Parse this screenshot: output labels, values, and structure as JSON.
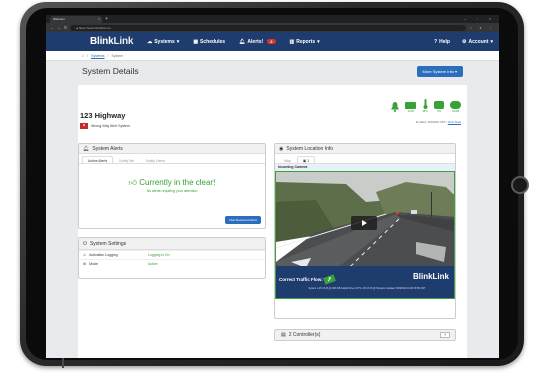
{
  "browser": {
    "tab_title": "Webcam",
    "new_tab": "+",
    "url": "https://www.blinklink.net"
  },
  "nav": {
    "logo_blink": "Blink",
    "logo_link": "Link",
    "systems": "Systems",
    "schedules": "Schedules",
    "alerts": "Alerts!",
    "alerts_count": "2",
    "reports": "Reports",
    "help": "Help",
    "account": "Account"
  },
  "breadcrumb": {
    "home": "⌂",
    "systems": "Systems",
    "sep": "/",
    "current": "System"
  },
  "page": {
    "title": "System Details",
    "more_info_button": "More System Info"
  },
  "system": {
    "name": "123 Highway",
    "type": "Wrong-Way Alert System",
    "status_labels": [
      "",
      "12.8V",
      "48°C",
      "ON",
      "34.6M"
    ],
    "last_updated": "11:20am, 8/3/2022 CDT •",
    "view_stats": "View Stats"
  },
  "alerts_panel": {
    "title": "System Alerts",
    "tabs": [
      "Active Alerts",
      "Notify Me",
      "Notify Users"
    ],
    "clear_message": "Currently in the clear!",
    "clear_sub": "No alerts requiring your attention",
    "resolved_button": "View Resolved Alerts"
  },
  "settings_panel": {
    "title": "System Settings",
    "rows": [
      {
        "label": "Activation Logging",
        "value": "Logging is On"
      },
      {
        "label": "Mode",
        "value": "Active"
      }
    ]
  },
  "location_panel": {
    "title": "System Location Info",
    "tabs": [
      "Map",
      "1"
    ],
    "incoming_label": "Incoming Camera",
    "traffic_flow": "Correct Traffic Flow:",
    "cam_logo": "BlinkLink",
    "cam_info": "System 1-45 US 45 @ 45th NB Capitol Drive CCTV I-45 US 45 @ Hampton  Updated: 8/03/2022 10:48:15 PM CDT"
  },
  "controllers": {
    "label": "2 Controller(s)",
    "toggle": "+"
  },
  "colors": {
    "nav_blue": "#1f3c6e",
    "accent_blue": "#2a6ebd",
    "status_green": "#3aa13a",
    "alert_red": "#d9342b"
  }
}
